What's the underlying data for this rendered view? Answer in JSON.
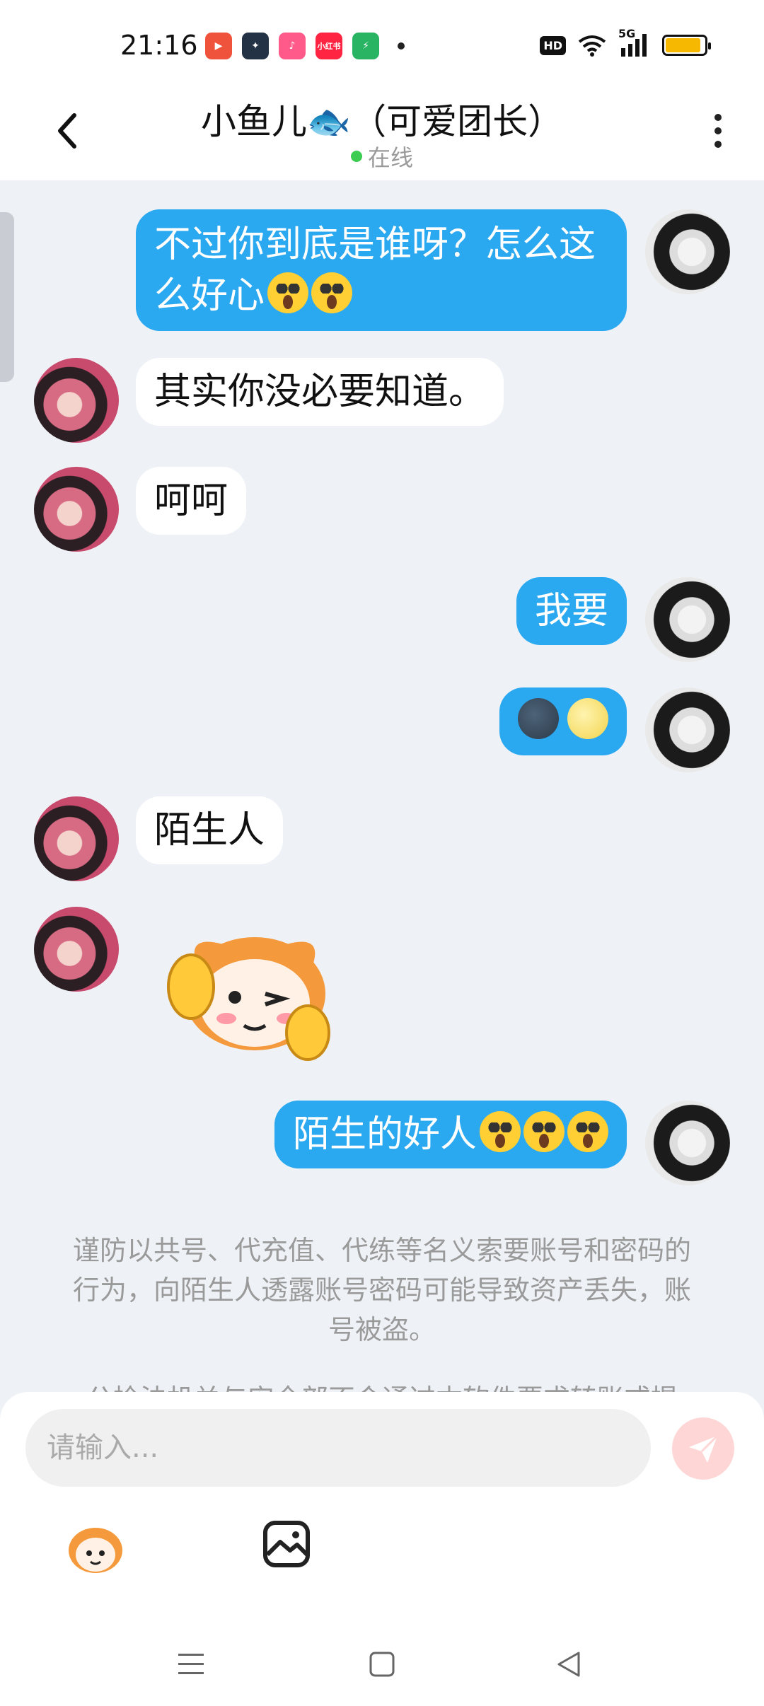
{
  "status_bar": {
    "time": "21:16",
    "apps": [
      {
        "icon": "video-app-icon",
        "color": "#f0533c"
      },
      {
        "icon": "game-app-icon",
        "color": "#233244"
      },
      {
        "icon": "music-app-icon",
        "color": "#ff5a8a"
      },
      {
        "icon": "xiaohongshu-app-icon",
        "color": "#ff2442",
        "label": "小红书"
      },
      {
        "icon": "security-app-icon",
        "color": "#28b463"
      }
    ],
    "hd_label": "HD",
    "network_label": "5G",
    "battery_level": 0.85,
    "battery_color": "#f6b800"
  },
  "header": {
    "title": "小鱼儿🐟（可爱团长）",
    "status": "在线",
    "online_color": "#3ccc52"
  },
  "messages": [
    {
      "from": "me",
      "text": "不过你到底是谁呀？怎么这么好心",
      "emojis": [
        "face-screaming",
        "face-screaming"
      ]
    },
    {
      "from": "her",
      "text": "其实你没必要知道。"
    },
    {
      "from": "her",
      "text": "呵呵"
    },
    {
      "from": "me",
      "text": "我要"
    },
    {
      "from": "me",
      "emojis": [
        "new-moon-face",
        "full-moon-face"
      ]
    },
    {
      "from": "her",
      "text": "陌生人"
    },
    {
      "from": "her",
      "sticker": "wink-ok-sticker"
    },
    {
      "from": "me",
      "text": "陌生的好人",
      "emojis": [
        "face-screaming",
        "face-screaming",
        "face-screaming"
      ]
    }
  ],
  "notice": "谨防以共号、代充值、代练等名义索要账号和密码的行为，向陌生人透露账号密码可能导致资产丢失，账号被盗。",
  "notice2": "公检法机关与安全部不会通过本软件要求转账或提交…",
  "input": {
    "placeholder": "请输入..."
  },
  "colors": {
    "my_bubble": "#2aa8f0",
    "her_bubble": "#ffffff",
    "background": "#eef2f7",
    "send_button": "#ffd6d6"
  }
}
